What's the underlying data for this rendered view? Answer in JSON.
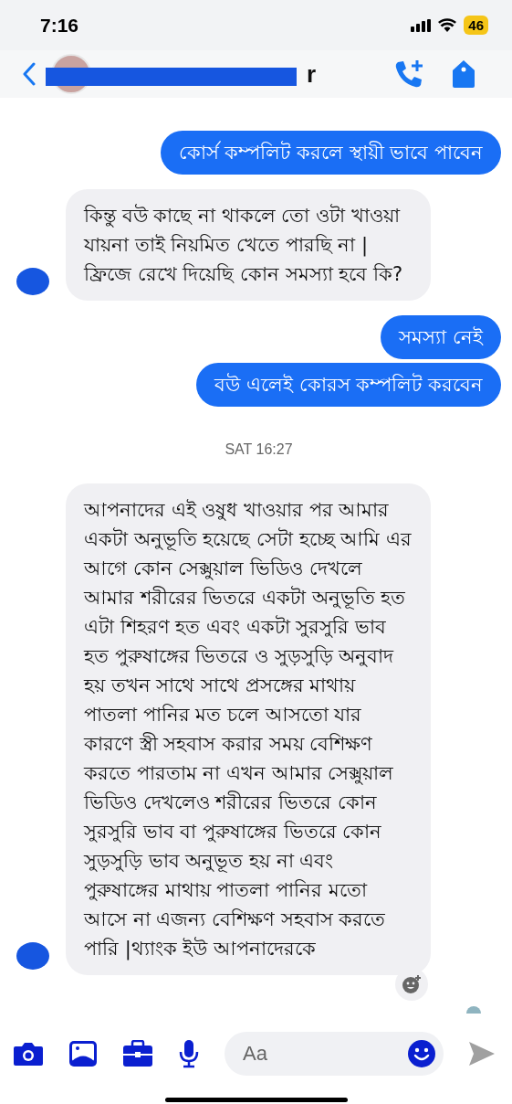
{
  "status_bar": {
    "time": "7:16",
    "battery": "46"
  },
  "header": {
    "contact_name_visible": "r",
    "name_redacted": true
  },
  "messages": [
    {
      "kind": "sent",
      "text": "কোর্স কম্পলিট করলে স্থায়ী ভাবে পাবেন"
    },
    {
      "kind": "received",
      "text": "কিন্তু বউ কাছে না থাকলে তো ওটা খাওয়া যায়না তাই নিয়মিত খেতে পারছি না | ফ্রিজে রেখে দিয়েছি কোন সমস্যা হবে কি?",
      "avatar": true
    },
    {
      "kind": "sent",
      "text": "সমস্যা নেই"
    },
    {
      "kind": "sent",
      "text": "বউ এলেই কোরস কম্পলিট করবেন"
    },
    {
      "kind": "timestamp",
      "text": "SAT 16:27"
    },
    {
      "kind": "received",
      "text": "আপনাদের এই ওষুধ খাওয়ার পর আমার একটা অনুভূতি হয়েছে সেটা হচ্ছে আমি এর আগে কোন সেক্সুয়াল ভিডিও দেখলে আমার শরীরের ভিতরে একটা অনুভূতি হত এটা শিহরণ হত এবং একটা সুরসুরি ভাব হত পুরুষাঙ্গের ভিতরে ও সুড়সুড়ি অনুবাদ হয় তখন সাথে সাথে প্রসঙ্গের মাথায় পাতলা পানির মত চলে আসতো যার কারণে স্ত্রী সহবাস করার সময় বেশিক্ষণ করতে পারতাম না এখন আমার সেক্সুয়াল ভিডিও দেখলেও শরীরের ভিতরে কোন সুরসুরি ভাব বা পুরুষাঙ্গের  ভিতরে কোন সুড়সুড়ি ভাব অনুভূত হয় না এবং পুরুষাঙ্গের মাথায় পাতলা পানির মতো আসে না এজন্য বেশিক্ষণ সহবাস করতে পারি |থ্যাংক ইউ আপনাদেরকে",
      "avatar": true,
      "reaction_button": true
    }
  ],
  "composer": {
    "placeholder": "Aa"
  }
}
